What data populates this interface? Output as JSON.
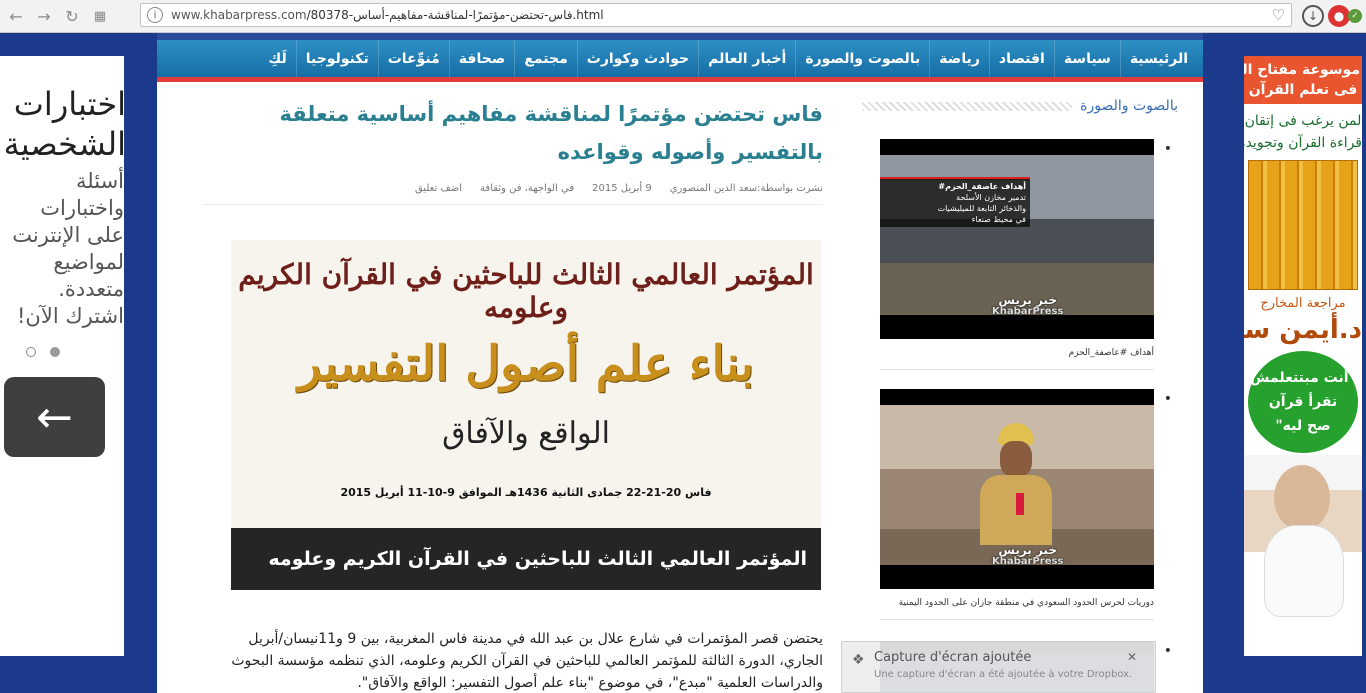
{
  "browser": {
    "url_host": "www.khabarpress.com",
    "url_path": "/80378-فاس-تحتضن-مؤتمرًا-لمناقشة-مفاهيم-أساس.html",
    "back_icon": "arrow-left-icon",
    "forward_icon": "arrow-right-icon",
    "reload_icon": "reload-icon",
    "apps_icon": "apps-grid-icon"
  },
  "left_ad": {
    "heading_line1": "اختبارات",
    "heading_line2": "الشخصية",
    "text_lines": [
      "أسئلة",
      "واختبارات",
      "على الإنترنت",
      "لمواضيع",
      "متعددة.",
      "اشترك الآن!"
    ],
    "arrow": "←"
  },
  "right_ad": {
    "banner_line1": "موسوعة مفتاح القرآن",
    "banner_line2": "فى تعلم القرآن",
    "line1": "لمن يرغب فى إتقان",
    "line2": "قراءة القرآن وتجويده",
    "review": "مراجعة المخارج",
    "name": "د.أيمن سويد",
    "circle_l1": "\"أنت مبتتعلمش",
    "circle_l2": "تقرأ قرآن",
    "circle_l3": "صح ليه\""
  },
  "menu": {
    "items": [
      "الرئيسية",
      "سياسة",
      "اقتصاد",
      "رياضة",
      "بالصوت والصورة",
      "أخبار العالم",
      "حوادث وكوارث",
      "مجتمع",
      "صحافة",
      "مُنوِّعات",
      "تكنولوجيا",
      "لَكِ"
    ]
  },
  "sidebar": {
    "title": "بالصوت والصورة",
    "videos": [
      {
        "overlay_tag": "أهداف عاصفة_الحزم#",
        "overlay_line1": "تدمير مخازن الأسلحة",
        "overlay_line2": "والذخائر التابعة للميليشيات",
        "overlay_line3": "في محيط صنعاء",
        "watermark": "خبر بريس",
        "watermark_en": "KhabarPress",
        "caption": "أهداف #عاصفة_الحزم"
      },
      {
        "watermark": "خبر بريس",
        "watermark_en": "KhabarPress",
        "caption": "دوريات لحرس الحدود السعودي في منطقة جازان على الحدود اليمنية"
      }
    ]
  },
  "article": {
    "title": "فاس تحتضن مؤتمرًا لمناقشة مفاهيم أساسية متعلقة بالتفسير وأصوله وقواعده",
    "meta": {
      "author": "نشرت بواسطة:سعد الدين المنصوري",
      "date": "9 أبريل 2015",
      "category": "في الواجهة، فن وثقافة",
      "comment": "اضف تعليق"
    },
    "hero": {
      "line1": "المؤتمر العالمي الثالث للباحثين في القرآن الكريم وعلومه",
      "line2": "بناء علم أصول التفسير",
      "line3": "الواقع والآفاق",
      "line4": "فاس 20-21-22 جمادى الثانية 1436هـ الموافق 9-10-11 أبريل 2015",
      "caption": "المؤتمر العالمي الثالث للباحثين في القرآن الكريم وعلومه"
    },
    "body_lines": [
      "يحتضن قصر المؤتمرات في شارع علال بن عبد الله في مدينة فاس المغربية، بين 9 و11نيسان/أبريل",
      "الجاري، الدورة الثالثة للمؤتمر العالمي للباحثين في القرآن الكريم وعلومه، الذي تنظمه مؤسسة البحوث",
      "والدراسات العلمية \"مبدع\"، في موضوع \"بناء علم أصول التفسير: الواقع والآفاق\"."
    ]
  },
  "toast": {
    "title": "Capture d'écran ajoutée",
    "message": "Une capture d'écran a été ajoutée à votre Dropbox."
  }
}
